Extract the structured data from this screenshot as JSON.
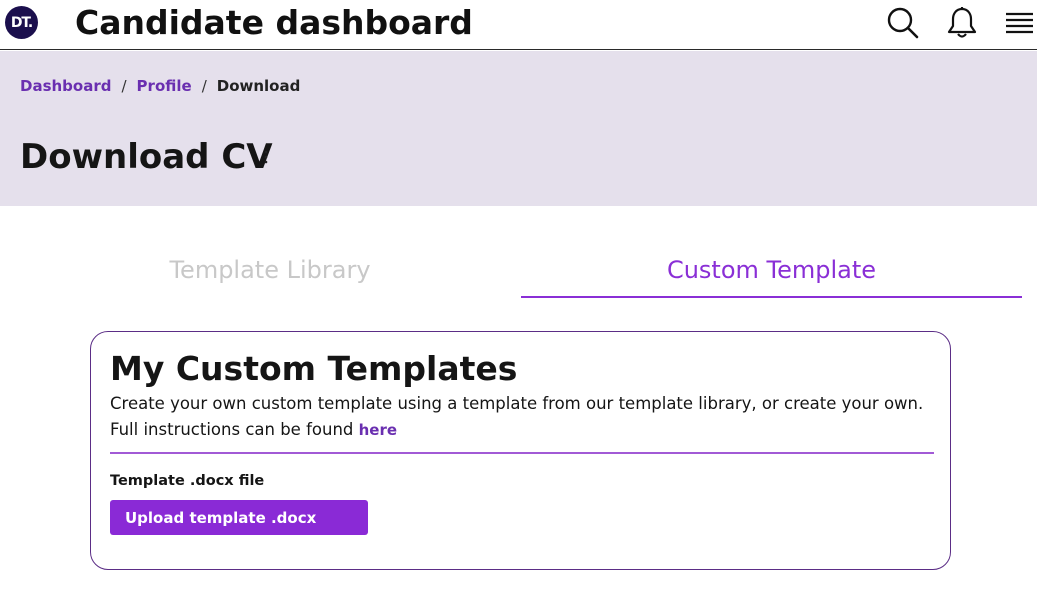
{
  "header": {
    "logo_text": "DT.",
    "title": "Candidate dashboard",
    "icons": [
      "search-icon",
      "bell-icon",
      "menu-icon"
    ]
  },
  "breadcrumb": {
    "items": [
      {
        "label": "Dashboard"
      },
      {
        "label": "Profile"
      },
      {
        "label": "Download"
      }
    ],
    "separator": "/"
  },
  "page": {
    "title": "Download CV"
  },
  "tabs": [
    {
      "label": "Template Library",
      "active": false
    },
    {
      "label": "Custom Template",
      "active": true
    }
  ],
  "card": {
    "title": "My Custom Templates",
    "description": "Create your own custom template using a template from our template library, or create your own.",
    "instructions_prefix": "Full instructions can be found",
    "instructions_link": "here",
    "field_label": "Template .docx file",
    "upload_button": "Upload template .docx"
  },
  "colors": {
    "accent": "#8a2ad6",
    "link": "#6a2fb0",
    "hero_bg": "#e5e0ec",
    "logo_bg": "#1b0f4d"
  }
}
